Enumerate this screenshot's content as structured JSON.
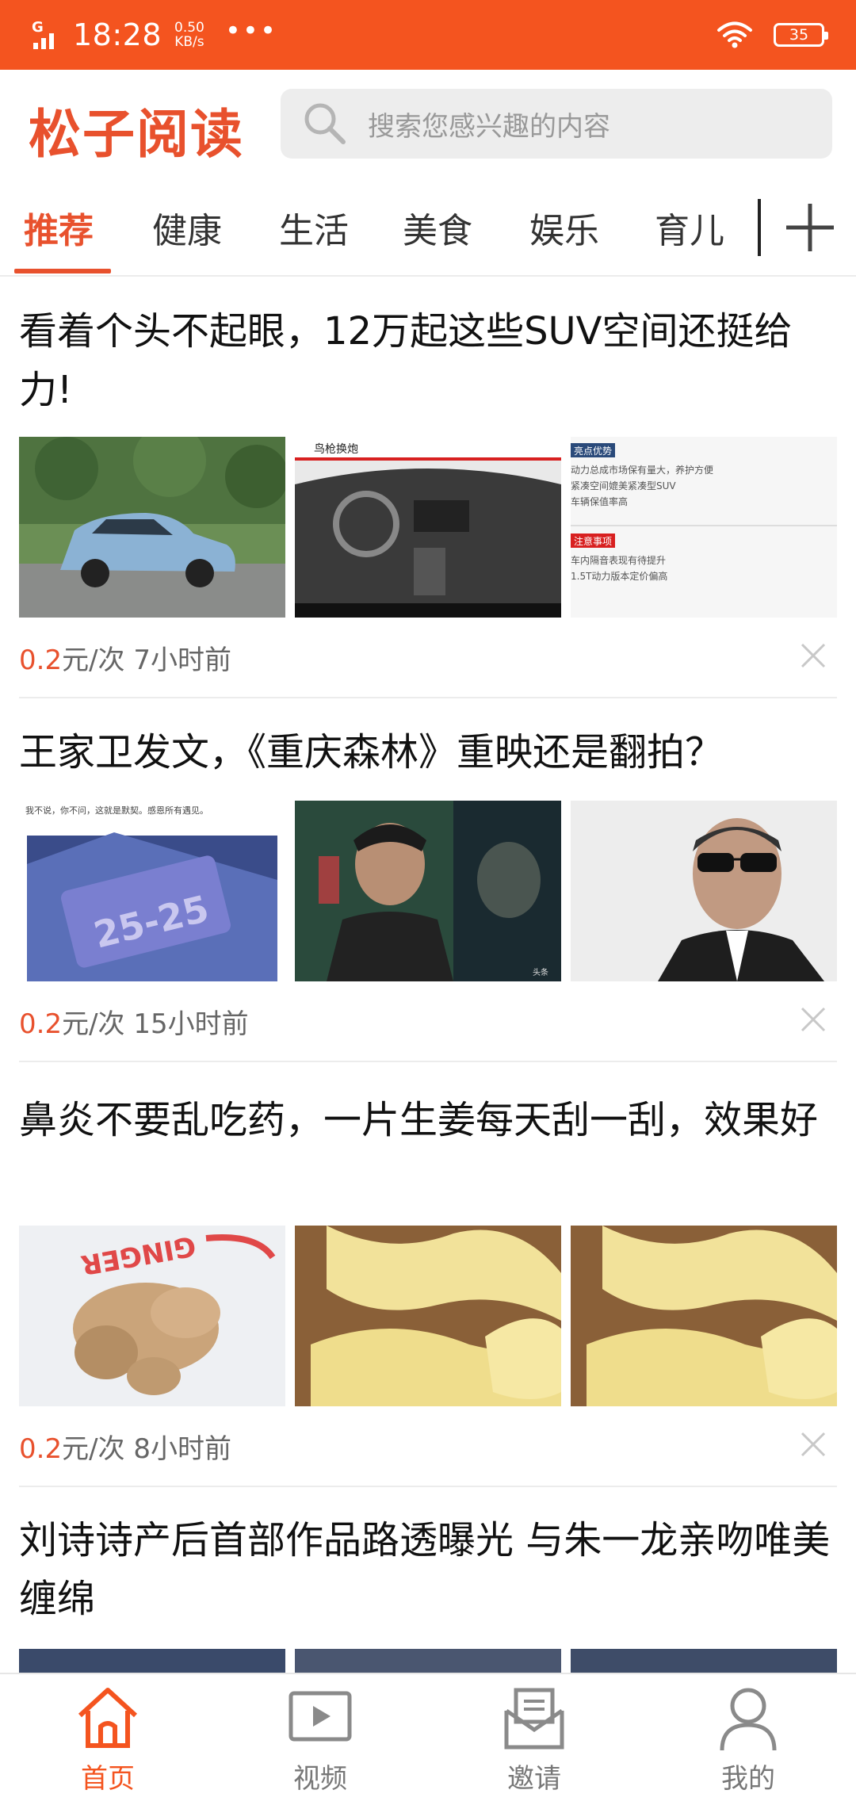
{
  "status": {
    "time": "18:28",
    "speed_value": "0.50",
    "speed_unit": "KB/s",
    "dots": "•••",
    "battery": "35",
    "network": "G"
  },
  "header": {
    "logo": "松子阅读",
    "search_placeholder": "搜索您感兴趣的内容"
  },
  "tabs": [
    "推荐",
    "健康",
    "生活",
    "美食",
    "娱乐",
    "育儿"
  ],
  "articles": [
    {
      "title": "看着个头不起眼，12万起这些SUV空间还挺给力!",
      "price": "0.2",
      "price_unit": "元/次",
      "time": "7小时前",
      "images": [
        "suv-photo",
        "suv-interior",
        "suv-spec-sheet"
      ],
      "img_text": {
        "interior_caption": "鸟枪换炮",
        "spec_heading1": "亮点优势",
        "spec_lines1": [
          "动力总成市场保有量大，养护方便",
          "紧凑空间媲美紧凑型SUV",
          "车辆保值率高"
        ],
        "spec_heading2": "注意事项",
        "spec_lines2": [
          "车内隔音表现有待提升",
          "1.5T动力版本定价偏高"
        ]
      }
    },
    {
      "title": "王家卫发文，《重庆森林》重映还是翻拍？",
      "price": "0.2",
      "price_unit": "元/次",
      "time": "15小时前",
      "images": [
        "license-plate",
        "film-still",
        "director-portrait"
      ],
      "img_text": {
        "note_text": "我不说，你不问，这就是默契。感恩所有遇见。",
        "plate_text": "25-25",
        "watermark": "头条"
      }
    },
    {
      "title": "鼻炎不要乱吃药，一片生姜每天刮一刮，效果好",
      "price": "0.2",
      "price_unit": "元/次",
      "time": "8小时前",
      "images": [
        "ginger-root",
        "ginger-slices",
        "ginger-slices"
      ],
      "img_text": {
        "bag_text": "GINGER"
      }
    },
    {
      "title": "刘诗诗产后首部作品路透曝光 与朱一龙亲吻唯美缠绵",
      "images": [
        "photo",
        "photo",
        "photo"
      ]
    }
  ],
  "nav": [
    {
      "label": "首页",
      "icon": "home-icon",
      "active": true
    },
    {
      "label": "视频",
      "icon": "video-icon",
      "active": false
    },
    {
      "label": "邀请",
      "icon": "invite-envelope-icon",
      "active": false
    },
    {
      "label": "我的",
      "icon": "profile-icon",
      "active": false
    }
  ],
  "colors": {
    "status_bar": "#f4541f",
    "brand": "#e8512d",
    "price": "#e8512d"
  }
}
